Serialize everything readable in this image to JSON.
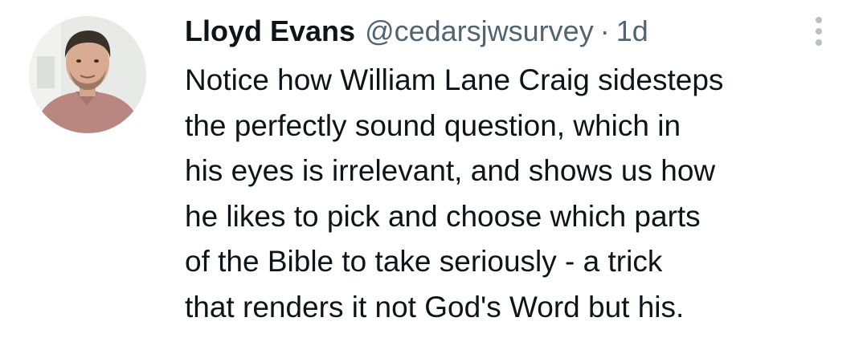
{
  "tweet": {
    "author": {
      "display_name": "Lloyd Evans",
      "handle": "@cedarsjwsurvey"
    },
    "separator": "·",
    "timestamp": "1d",
    "more_icon": "more-vertical-icon",
    "text_lines": [
      "Notice how William Lane Craig sidesteps",
      "the perfectly sound question, which in",
      "his eyes is irrelevant, and shows us how",
      "he likes to pick and choose which parts",
      "of the Bible to take seriously - a trick",
      "that renders it not God's Word but his."
    ]
  },
  "colors": {
    "text": "#0f1419",
    "secondary_text": "#536471",
    "more_icon": "#b8c0c7"
  }
}
